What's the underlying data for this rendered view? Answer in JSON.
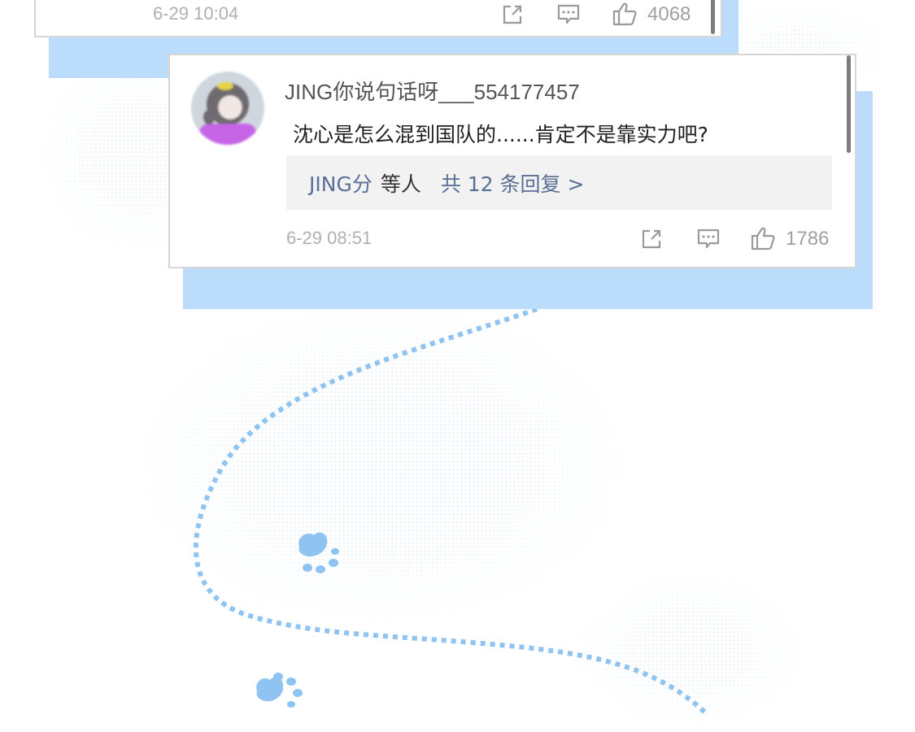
{
  "top_comment": {
    "time": "6-29 10:04",
    "likes": "4068"
  },
  "comment": {
    "username": "JING你说句话呀___554177457",
    "text": "沈心是怎么混到国队的......肯定不是靠实力吧?",
    "reply_names": "JING分",
    "reply_others": "等人",
    "reply_total": "共 12 条回复 >",
    "time": "6-29 08:51",
    "likes": "1786"
  },
  "icons": {
    "share": "share-icon",
    "reply": "comment-icon",
    "like": "thumbs-up-icon",
    "paw": "paw-print-icon"
  },
  "colors": {
    "accent_blue": "#bcdcfb",
    "reply_link": "#5b6f95",
    "paw": "#8ec3f2"
  }
}
